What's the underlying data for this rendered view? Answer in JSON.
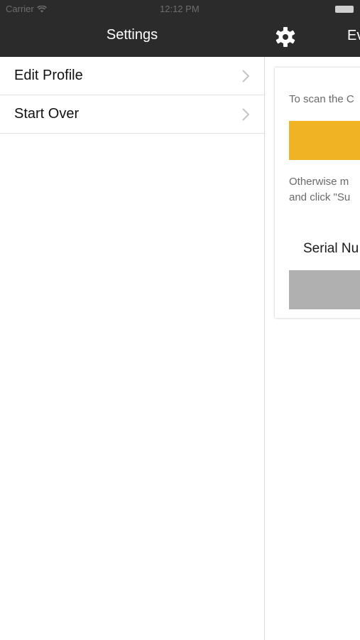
{
  "status_bar": {
    "carrier": "Carrier",
    "time": "12:12 PM"
  },
  "settings": {
    "title": "Settings",
    "items": [
      {
        "label": "Edit Profile"
      },
      {
        "label": "Start Over"
      }
    ]
  },
  "main": {
    "title": "Ev",
    "scan_instruction": "To scan the C",
    "otherwise_line1": "Otherwise m",
    "otherwise_line2": "and click \"Su",
    "serial_label": "Serial Nu"
  },
  "colors": {
    "nav_background": "#2b2b2b",
    "scan_button": "#f0b323",
    "serial_field": "#b0b0b0"
  },
  "icons": [
    "wifi-icon",
    "battery-icon",
    "gear-icon",
    "chevron-right-icon"
  ]
}
